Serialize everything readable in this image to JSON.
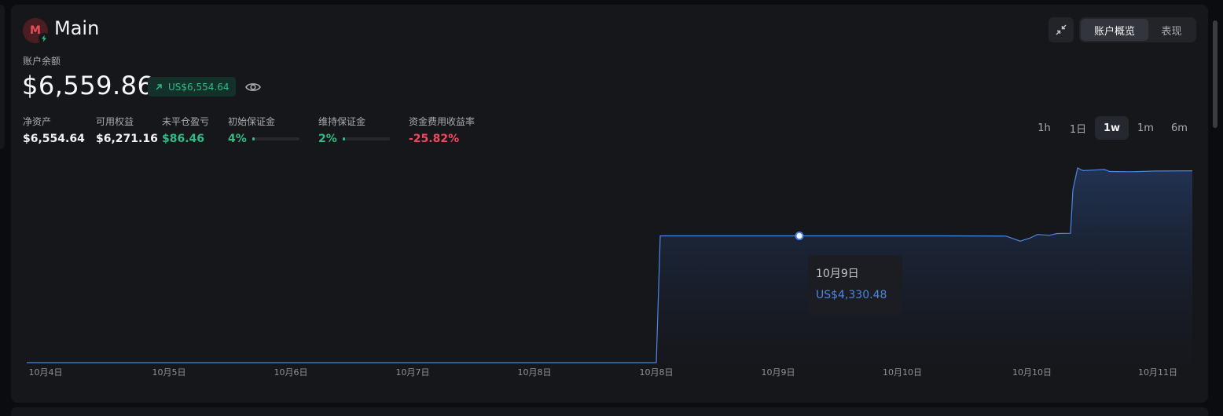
{
  "account": {
    "avatar_letter": "M",
    "name": "Main",
    "balance_label": "账户余额",
    "balance": "$6,559.86",
    "delta": "US$6,554.64"
  },
  "stats": [
    {
      "label": "净资产",
      "value": "$6,554.64",
      "color": "white"
    },
    {
      "label": "可用权益",
      "value": "$6,271.16",
      "color": "white"
    },
    {
      "label": "未平仓盈亏",
      "value": "$86.46",
      "color": "green"
    },
    {
      "label": "初始保证金",
      "value": "4%",
      "color": "green",
      "bar_fraction": 0.04
    },
    {
      "label": "维持保证金",
      "value": "2%",
      "color": "green",
      "bar_fraction": 0.02
    },
    {
      "label": "资金费用收益率",
      "value": "-25.82%",
      "color": "red"
    }
  ],
  "view_tabs": [
    {
      "label": "账户概览",
      "active": true
    },
    {
      "label": "表现",
      "active": false
    }
  ],
  "timeframes": [
    {
      "label": "1h",
      "active": false
    },
    {
      "label": "1日",
      "active": false
    },
    {
      "label": "1w",
      "active": true
    },
    {
      "label": "1m",
      "active": false
    },
    {
      "label": "6m",
      "active": false
    }
  ],
  "tooltip": {
    "date": "10月9日",
    "value": "US$4,330.48"
  },
  "colors": {
    "accent_green": "#2ebd85",
    "accent_red": "#f6465d",
    "line_blue": "#4d86e0"
  },
  "chart_data": {
    "type": "area",
    "x_tick_labels": [
      "10月4日",
      "10月5日",
      "10月6日",
      "10月7日",
      "10月8日",
      "10月8日",
      "10月9日",
      "10月10日",
      "10月10日",
      "10月11日"
    ],
    "series": [
      {
        "points": [
          [
            "10月4日",
            0
          ],
          [
            "10月8日",
            0
          ],
          [
            "10月8日",
            4330
          ],
          [
            "10月9日",
            4330.48
          ],
          [
            "10月10日",
            4330
          ],
          [
            "10月10日",
            4150
          ],
          [
            "10月10日",
            4380
          ],
          [
            "10月10日",
            4420
          ],
          [
            "10月10日",
            6650
          ],
          [
            "10月11日",
            6554.64
          ]
        ]
      }
    ],
    "highlight_point": {
      "x": "10月9日",
      "y": 4330.48
    },
    "grid": false,
    "legend": "none"
  }
}
